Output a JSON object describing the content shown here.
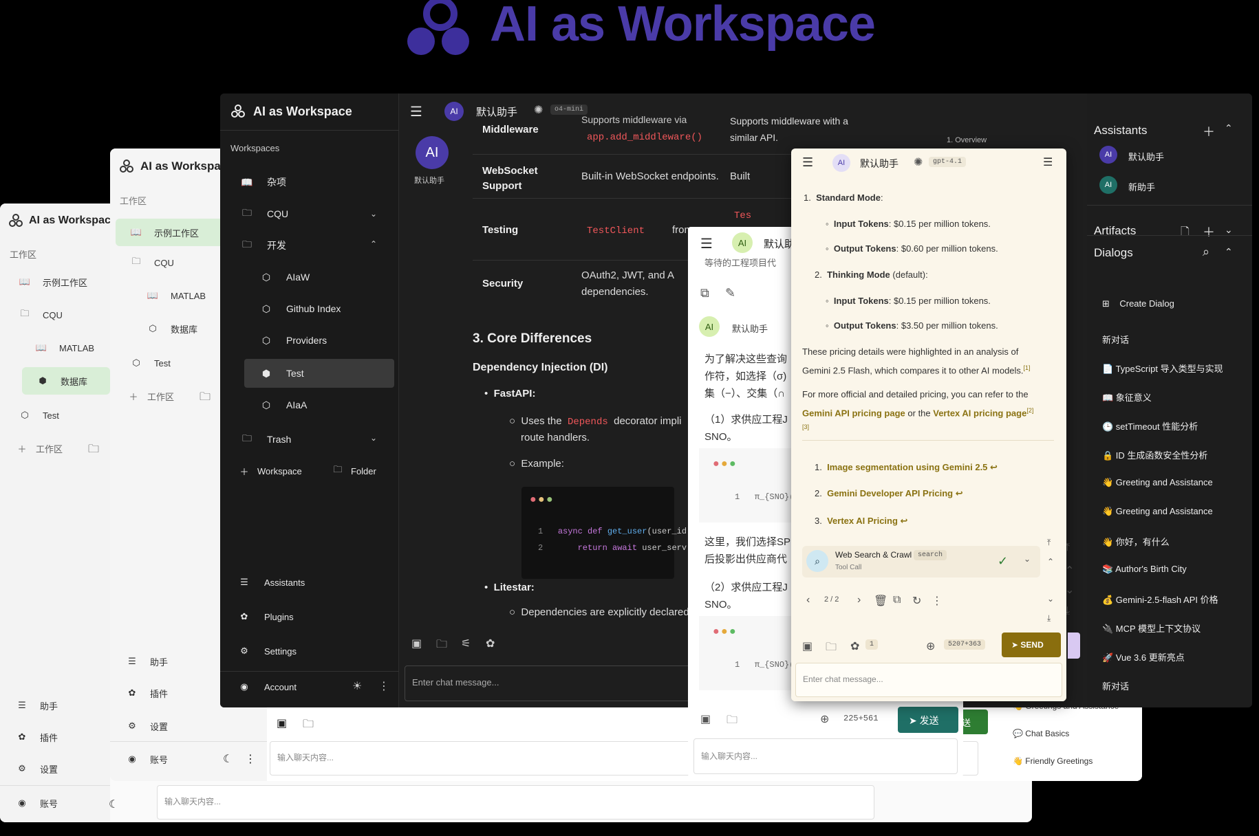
{
  "hero": {
    "title": "AI as Workspace"
  },
  "win3": {
    "app_title": "AI as Workspac",
    "section": "工作区",
    "items": [
      "示例工作区",
      "CQU",
      "MATLAB",
      "数据库",
      "Test"
    ],
    "add_workspace": "工作区",
    "bottom": [
      "助手",
      "插件",
      "设置"
    ],
    "account": "账号",
    "input_placeholder": "输入聊天内容..."
  },
  "win2": {
    "app_title": "AI as Workspace",
    "section": "工作区",
    "items": [
      "示例工作区",
      "CQU",
      "MATLAB",
      "数据库",
      "Test"
    ],
    "add_workspace": "工作区",
    "bottom": [
      "助手",
      "插件",
      "设置"
    ],
    "account": "账号",
    "input_placeholder": "输入聊天内容...",
    "dialogs": [
      "Greetings and Assistance",
      "Chat Basics",
      "Friendly Greetings"
    ],
    "send_label": "送"
  },
  "main": {
    "app_title": "AI as Workspace",
    "header": {
      "assistant": "默认助手",
      "model": "o4-mini",
      "avatar": "AI"
    },
    "workspaces_label": "Workspaces",
    "tree": [
      {
        "label": "杂项"
      },
      {
        "label": "CQU"
      },
      {
        "label": "开发"
      },
      {
        "label": "AIaW"
      },
      {
        "label": "Github Index"
      },
      {
        "label": "Providers"
      },
      {
        "label": "Test"
      },
      {
        "label": "AIaA"
      },
      {
        "label": "Trash"
      }
    ],
    "add_workspace": "Workspace",
    "add_folder": "Folder",
    "nav": [
      "Assistants",
      "Plugins",
      "Settings"
    ],
    "account": "Account",
    "input_placeholder": "Enter chat message...",
    "assistant_avatar": {
      "initials": "AI",
      "name": "默认助手"
    },
    "table": [
      {
        "h": "Middleware",
        "c1a": "Supports middleware via",
        "c1b": "app.add_middleware()",
        "c1c": ".",
        "c2": "Supports middleware with a similar API."
      },
      {
        "h": "WebSocket Support",
        "c1": "Built-in WebSocket endpoints.",
        "c2": "Built"
      },
      {
        "h": "Testing",
        "c1a": "TestClient",
        "c1b": "from",
        "c2": "Tes"
      },
      {
        "h": "Security",
        "c1": "OAuth2, JWT, and A",
        "c1b": "dependencies.",
        "c2": ""
      }
    ],
    "section_title": "3. Core Differences",
    "subsection": "Dependency Injection (DI)",
    "fastapi": "FastAPI:",
    "uses_the": "Uses the",
    "depends": "Depends",
    "decorator": "decorator impli",
    "route_handlers": "route handlers.",
    "example": "Example:",
    "code_line1_kw": "async def",
    "code_line1_fn": "get_user",
    "code_line1_rest": "(user_id",
    "code_line2_kw": "return await",
    "code_line2_rest": "user_serv",
    "litestar": "Litestar:",
    "litestar_desc": "Dependencies are explicitly declared",
    "overview": "1. Overview"
  },
  "right_panel": {
    "assistants_title": "Assistants",
    "assistants": [
      "默认助手",
      "新助手"
    ],
    "artifacts_title": "Artifacts",
    "dialogs_title": "Dialogs",
    "create_dialog": "Create Dialog",
    "dialogs": [
      "新对话",
      "📄 TypeScript 导入类型与实现",
      "📖 象征意义",
      "🕒 setTimeout 性能分析",
      "🔒 ID 生成函数安全性分析",
      "👋 Greeting and Assistance",
      "👋 Greeting and Assistance",
      "👋 你好，有什么",
      "📚 Author's Birth City",
      "💰 Gemini-2.5-flash API 价格",
      "🔌 MCP 模型上下文协议",
      "🚀 Vue 3.6 更新亮点",
      "新对话"
    ]
  },
  "white_chat": {
    "assistant": "默认助",
    "avatar": "AI",
    "sender": "默认助手",
    "cut_top": "等待的工程项目代",
    "p1": [
      "为了解决这些查询",
      "作符，如选择（σ)",
      "集（−）、交集（∩"
    ],
    "p2": [
      "（1）求供应工程J",
      "SNO。"
    ],
    "code": "π_{SNO}(σ_{",
    "p3": [
      "这里，我们选择SP",
      "后投影出供应商代"
    ],
    "p4": [
      "（2）求供应工程J",
      "SNO。"
    ],
    "code2": "π_{SNO}(σ_{",
    "tokens": "225+561",
    "send_label": "发送",
    "input_placeholder": "输入聊天内容..."
  },
  "cream": {
    "assistant": "默认助手",
    "model": "gpt-4.1",
    "avatar": "AI",
    "standard_mode": "Standard Mode",
    "input_tokens_label": "Input Tokens",
    "std_input": ": $0.15 per million tokens.",
    "output_tokens_label": "Output Tokens",
    "std_output": ": $0.60 per million tokens.",
    "thinking_mode": "Thinking Mode",
    "default": " (default):",
    "think_input": ": $0.15 per million tokens.",
    "think_output": ": $3.50 per million tokens.",
    "para1a": "These pricing details were highlighted in an analysis of",
    "para1b": "Gemini 2.5 Flash, which compares it to other AI models.",
    "ref1": "[1]",
    "para2a": "For more official and detailed pricing, you can refer to the",
    "link1": "Gemini API pricing page",
    "or_the": " or the ",
    "link2": "Vertex AI pricing page",
    "ref2": "[2]",
    "ref3": "[3]",
    "sources": [
      "Image segmentation using Gemini 2.5 ↩",
      "Gemini Developer API Pricing ↩",
      "Vertex AI Pricing ↩"
    ],
    "tool_name": "Web Search & Crawl",
    "tool_tag": "search",
    "tool_sub": "Tool Call",
    "pager": "2 / 2",
    "plugin_count": "1",
    "tokens": "5207+363",
    "send_label": "SEND",
    "input_placeholder": "Enter chat message..."
  },
  "colors": {
    "accent_purple": "#4a3ba8",
    "green": "#2e7d32",
    "olive": "#8a7212",
    "teal": "#1f6f66"
  }
}
